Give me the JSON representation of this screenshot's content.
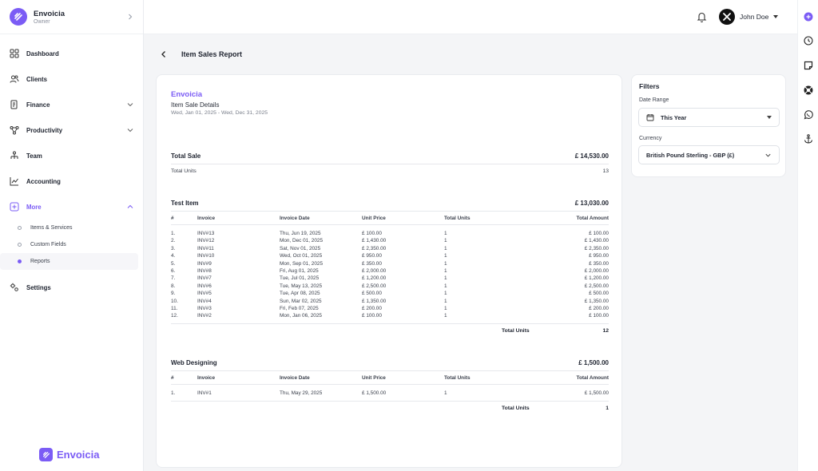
{
  "app": {
    "name": "Envoicia",
    "role": "Owner",
    "footer_name": "Envoicia"
  },
  "nav": {
    "dashboard": "Dashboard",
    "clients": "Clients",
    "finance": "Finance",
    "productivity": "Productivity",
    "team": "Team",
    "accounting": "Accounting",
    "more": "More",
    "sub": [
      "Items & Services",
      "Custom Fields",
      "Reports"
    ],
    "settings": "Settings"
  },
  "header": {
    "user_name": "John Doe"
  },
  "page": {
    "title": "Item Sales Report"
  },
  "report": {
    "brand": "Envoicia",
    "subtitle": "Item Sale Details",
    "range": "Wed, Jan 01, 2025 - Wed, Dec 31, 2025",
    "total_sale_label": "Total Sale",
    "total_sale_value": "£ 14,530.00",
    "total_units_label": "Total Units",
    "total_units_value": "13",
    "columns": [
      "#",
      "Invoice",
      "Invoice Date",
      "Unit Price",
      "Total Units",
      "Total Amount"
    ],
    "groups": [
      {
        "name": "Test Item",
        "amount": "£ 13,030.00",
        "rows": [
          [
            "1.",
            "INV#13",
            "Thu, Jun 19, 2025",
            "£ 100.00",
            "1",
            "£ 100.00"
          ],
          [
            "2.",
            "INV#12",
            "Mon, Dec 01, 2025",
            "£ 1,430.00",
            "1",
            "£ 1,430.00"
          ],
          [
            "3.",
            "INV#11",
            "Sat, Nov 01, 2025",
            "£ 2,350.00",
            "1",
            "£ 2,350.00"
          ],
          [
            "4.",
            "INV#10",
            "Wed, Oct 01, 2025",
            "£ 950.00",
            "1",
            "£ 950.00"
          ],
          [
            "5.",
            "INV#9",
            "Mon, Sep 01, 2025",
            "£ 350.00",
            "1",
            "£ 350.00"
          ],
          [
            "6.",
            "INV#8",
            "Fri, Aug 01, 2025",
            "£ 2,000.00",
            "1",
            "£ 2,000.00"
          ],
          [
            "7.",
            "INV#7",
            "Tue, Jul 01, 2025",
            "£ 1,200.00",
            "1",
            "£ 1,200.00"
          ],
          [
            "8.",
            "INV#6",
            "Tue, May 13, 2025",
            "£ 2,500.00",
            "1",
            "£ 2,500.00"
          ],
          [
            "9.",
            "INV#5",
            "Tue, Apr 08, 2025",
            "£ 500.00",
            "1",
            "£ 500.00"
          ],
          [
            "10.",
            "INV#4",
            "Sun, Mar 02, 2025",
            "£ 1,350.00",
            "1",
            "£ 1,350.00"
          ],
          [
            "11.",
            "INV#3",
            "Fri, Feb 07, 2025",
            "£ 200.00",
            "1",
            "£ 200.00"
          ],
          [
            "12.",
            "INV#2",
            "Mon, Jan 06, 2025",
            "£ 100.00",
            "1",
            "£ 100.00"
          ]
        ],
        "total_units_label": "Total Units",
        "total_units": "12"
      },
      {
        "name": "Web Designing",
        "amount": "£ 1,500.00",
        "rows": [
          [
            "1.",
            "INV#1",
            "Thu, May 29, 2025",
            "£ 1,500.00",
            "1",
            "£ 1,500.00"
          ]
        ],
        "total_units_label": "Total Units",
        "total_units": "1"
      }
    ]
  },
  "filters": {
    "title": "Filters",
    "date_range_label": "Date Range",
    "date_range_value": "This Year",
    "currency_label": "Currency",
    "currency_value": "British Pound Sterling - GBP (£)"
  },
  "colors": {
    "accent": "#7b5cf5",
    "text": "#1f2430",
    "muted": "#7a7f8b",
    "border": "#e9ebef",
    "background": "#f4f5f7"
  },
  "icons": {
    "rail": [
      "plus-circle-icon",
      "history-icon",
      "note-icon",
      "support-icon",
      "whatsapp-icon",
      "anchor-icon"
    ]
  }
}
